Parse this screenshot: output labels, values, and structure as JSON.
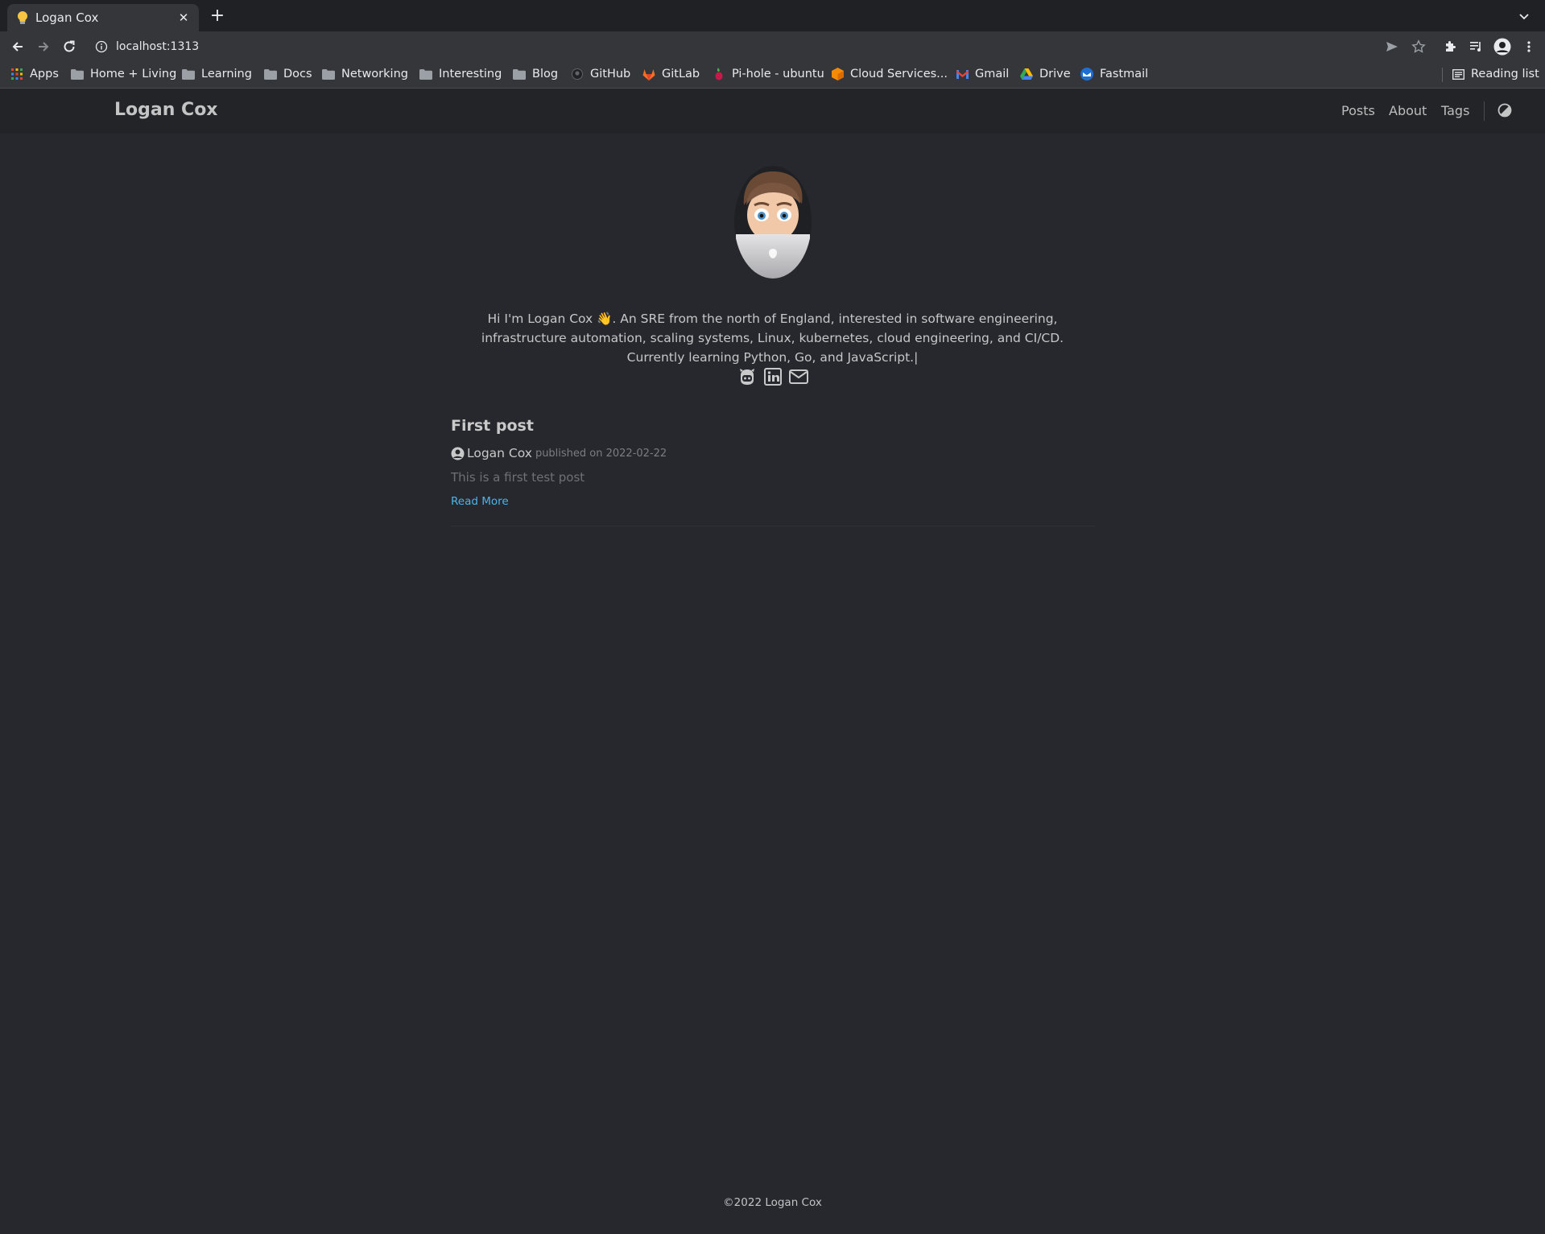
{
  "browser": {
    "tab_title": "Logan Cox",
    "url": "localhost:1313",
    "bookmarks": [
      {
        "label": "Apps",
        "icon": "apps-grid-icon"
      },
      {
        "label": "Home + Living",
        "icon": "folder-icon"
      },
      {
        "label": "Learning",
        "icon": "folder-icon"
      },
      {
        "label": "Docs",
        "icon": "folder-icon"
      },
      {
        "label": "Networking",
        "icon": "folder-icon"
      },
      {
        "label": "Interesting",
        "icon": "folder-icon"
      },
      {
        "label": "Blog",
        "icon": "folder-icon"
      },
      {
        "label": "GitHub",
        "icon": "github-icon"
      },
      {
        "label": "GitLab",
        "icon": "gitlab-icon"
      },
      {
        "label": "Pi-hole - ubuntu",
        "icon": "pihole-icon"
      },
      {
        "label": "Cloud Services...",
        "icon": "cloud-icon"
      },
      {
        "label": "Gmail",
        "icon": "gmail-icon"
      },
      {
        "label": "Drive",
        "icon": "drive-icon"
      },
      {
        "label": "Fastmail",
        "icon": "fastmail-icon"
      }
    ],
    "reading_list": "Reading list"
  },
  "site": {
    "brand": "Logan Cox",
    "nav": [
      "Posts",
      "About",
      "Tags"
    ],
    "bio": "Hi I'm Logan Cox 👋. An SRE from the north of England, interested in software engineering, infrastructure automation, scaling systems, Linux, kubernetes, cloud engineering, and CI/CD. Currently learning Python, Go, and JavaScript.|",
    "social_icons": [
      "github-icon",
      "linkedin-icon",
      "email-icon"
    ]
  },
  "post": {
    "title": "First post",
    "author": "Logan Cox",
    "published": "published on 2022-02-22",
    "summary": "This is a first test post",
    "read_more": "Read More"
  },
  "footer": {
    "copyright": "©2022 Logan Cox"
  },
  "colors": {
    "page_bg": "#27282d",
    "header_bg": "#232428",
    "link": "#4fb3e6"
  }
}
